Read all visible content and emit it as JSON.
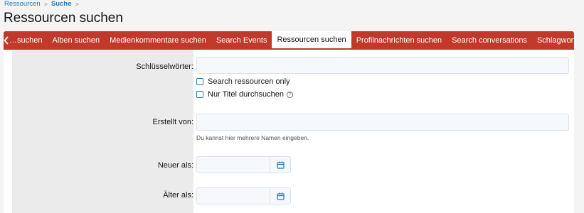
{
  "breadcrumb": {
    "items": [
      "Ressourcen",
      "Suche"
    ],
    "separator": ">"
  },
  "page_title": "Ressourcen suchen",
  "tabs": {
    "prev_icon": "chevron-left-icon",
    "items": [
      {
        "label": "…suchen"
      },
      {
        "label": "Alben suchen"
      },
      {
        "label": "Medienkommentare suchen"
      },
      {
        "label": "Search Events"
      },
      {
        "label": "Ressourcen suchen",
        "active": true
      },
      {
        "label": "Profilnachrichten suchen"
      },
      {
        "label": "Search conversations"
      },
      {
        "label": "Schlagworte suchen"
      }
    ]
  },
  "form": {
    "keywords_label": "Schlüsselwörter:",
    "keywords_value": "",
    "check_resources_only": "Search ressourcen only",
    "check_titles_only": "Nur Titel durchsuchen",
    "help_icon": "question-circle-icon",
    "created_by_label": "Erstellt von:",
    "created_by_value": "",
    "created_by_hint": "Du kannst hier mehrere Namen eingeben.",
    "newer_than_label": "Neuer als:",
    "older_than_label": "Älter als:",
    "calendar_icon": "calendar-icon"
  },
  "colors": {
    "accent": "#c0392b",
    "link": "#2577b1",
    "label_column": "#ebebeb"
  }
}
